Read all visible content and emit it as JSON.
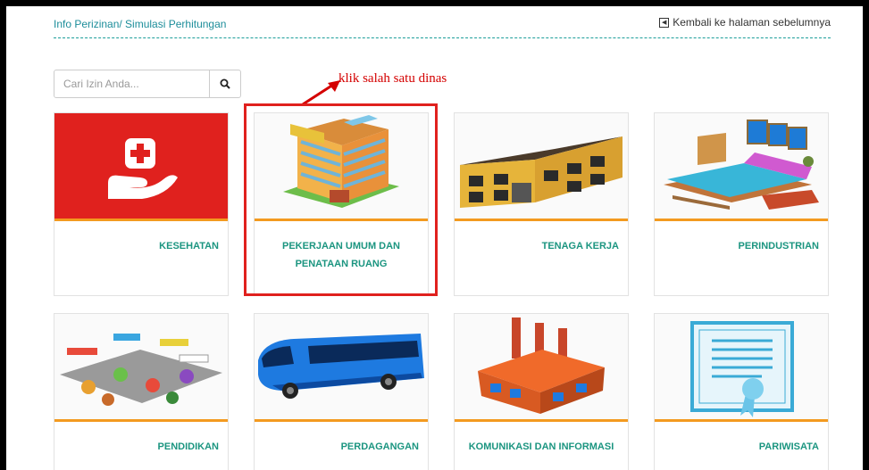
{
  "header": {
    "breadcrumb": "Info Perizinan/ Simulasi Perhitungan",
    "back_label": "Kembali ke halaman sebelumnya"
  },
  "search": {
    "placeholder": "Cari Izin Anda...",
    "button_icon": "search-icon"
  },
  "annotation": {
    "text": "klik salah satu dinas",
    "color": "#d40000"
  },
  "colors": {
    "accent": "#f39a1f",
    "label": "#1b9580",
    "link": "#1c8d9a",
    "highlight": "#e0211e"
  },
  "services": [
    {
      "label": "KESEHATAN",
      "icon": "health-hand-icon"
    },
    {
      "label": "PEKERJAAN UMUM DAN PENATAAN RUANG",
      "icon": "hotel-building-icon"
    },
    {
      "label": "TENAGA KERJA",
      "icon": "office-building-icon"
    },
    {
      "label": "PERINDUSTRIAN",
      "icon": "bedroom-icon"
    },
    {
      "label": "PENDIDIKAN",
      "icon": "market-stalls-icon"
    },
    {
      "label": "PERDAGANGAN",
      "icon": "bus-icon"
    },
    {
      "label": "KOMUNIKASI DAN INFORMASI",
      "icon": "factory-icon"
    },
    {
      "label": "PARIWISATA",
      "icon": "certificate-icon"
    }
  ]
}
